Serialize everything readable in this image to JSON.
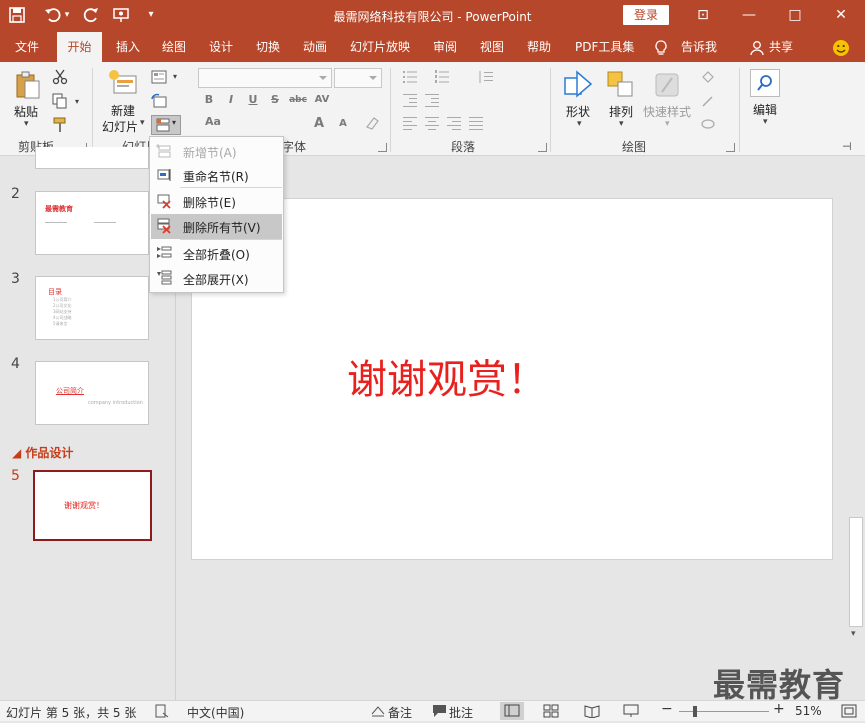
{
  "window": {
    "title": "最需网络科技有限公司  -  PowerPoint",
    "login_label": "登录",
    "controls": {
      "ribbon_display": "⊡",
      "minimize": "—",
      "maximize": "□",
      "close": "✕"
    }
  },
  "quick_access": {
    "save_icon": "save-icon",
    "undo_icon": "undo-icon",
    "redo_icon": "redo-icon",
    "present_icon": "present-from-start-icon",
    "customize": "▾"
  },
  "tabs": [
    {
      "label": "文件"
    },
    {
      "label": "开始"
    },
    {
      "label": "插入"
    },
    {
      "label": "绘图"
    },
    {
      "label": "设计"
    },
    {
      "label": "切换"
    },
    {
      "label": "动画"
    },
    {
      "label": "幻灯片放映"
    },
    {
      "label": "审阅"
    },
    {
      "label": "视图"
    },
    {
      "label": "帮助"
    },
    {
      "label": "PDF工具集"
    },
    {
      "label": "告诉我"
    },
    {
      "label": "共享"
    }
  ],
  "active_tab": "开始",
  "ribbon": {
    "clipboard": {
      "paste": "粘贴",
      "label": "剪贴板"
    },
    "slides": {
      "new_slide_line1": "新建",
      "new_slide_line2": "幻灯片",
      "label": "幻灯片"
    },
    "font": {
      "label": "字体",
      "bold": "B",
      "italic": "I",
      "underline": "U",
      "strike": "S",
      "shadow_abc": "abc",
      "spacing": "AV",
      "case": "Aa",
      "grow": "A",
      "shrink": "A"
    },
    "paragraph": {
      "label": "段落"
    },
    "drawing": {
      "label": "绘图",
      "shape": "形状",
      "arrange": "排列",
      "quick_style": "快速样式"
    },
    "editing": {
      "label": "编辑"
    }
  },
  "section_menu": {
    "items": [
      {
        "label": "新增节(A)",
        "enabled": false
      },
      {
        "label": "重命名节(R)",
        "enabled": true
      },
      {
        "label": "删除节(E)",
        "enabled": true
      },
      {
        "label": "删除所有节(V)",
        "enabled": true,
        "hovered": true
      },
      {
        "label": "全部折叠(O)",
        "enabled": true
      },
      {
        "label": "全部展开(X)",
        "enabled": true
      }
    ]
  },
  "thumbnails": {
    "slide2": {
      "num": "2",
      "title": "最需教育"
    },
    "slide3": {
      "num": "3",
      "title": "目录",
      "items": [
        "1公司简介",
        "2公司文化",
        "3网站支持",
        "4公司战略",
        "5请来言"
      ]
    },
    "slide4": {
      "num": "4",
      "title": "公司简介",
      "subtitle": "company introduction"
    },
    "section_name": "作品设计",
    "slide5": {
      "num": "5",
      "text": "谢谢观赏！"
    }
  },
  "slide": {
    "text": "谢谢观赏！"
  },
  "status": {
    "slide_info": "幻灯片 第 5 张，共 5 张",
    "language": "中文(中国)",
    "notes": "备注",
    "comments": "批注",
    "zoom": "51%",
    "zoom_minus": "−",
    "zoom_plus": "+"
  },
  "watermark": "最需教育",
  "colors": {
    "accent": "#b7472a",
    "slide_text": "#e8211e",
    "section_label": "#c43e1c",
    "selected_border": "#8e1b1b"
  }
}
